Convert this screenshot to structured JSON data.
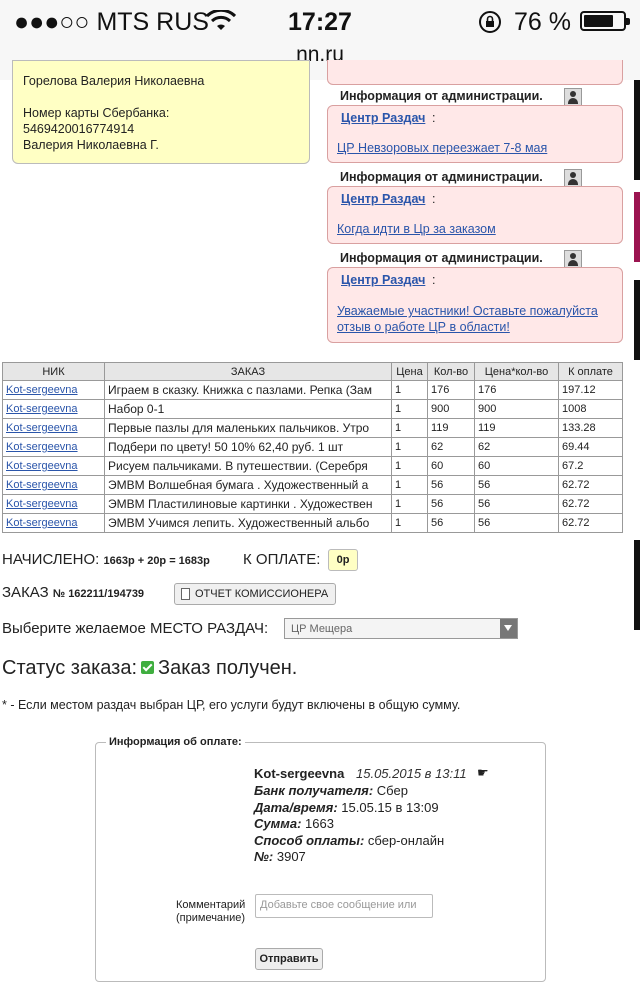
{
  "status_bar": {
    "carrier": "●●●○○ MTS RUS",
    "time": "17:27",
    "battery_percent": "76 %",
    "battery_level": 0.76,
    "url": "nn.ru"
  },
  "info_box": {
    "name": "Горелова Валерия Николаевна",
    "card_label": "Номер карты Сбербанка:",
    "card_number": "5469420016774914",
    "owner": "Валерия Николаевна Г."
  },
  "admin_messages": [
    {
      "title": "Информация от администрации.",
      "source": "Центр Раздач",
      "text": "ЦР Невзоровых переезжает 7-8 мая"
    },
    {
      "title": "Информация от администрации.",
      "source": "Центр Раздач",
      "text": "Когда идти в Цр за заказом"
    },
    {
      "title": "Информация от администрации.",
      "source": "Центр Раздач",
      "text": "Уважаемые участники! Оставьте пожалуйста отзыв о работе ЦР в области!"
    }
  ],
  "table": {
    "headers": [
      "НИК",
      "ЗАКАЗ",
      "Цена",
      "Кол-во",
      "Цена*кол-во",
      "К оплате"
    ],
    "rows": [
      [
        "Kot-sergeevna",
        "Играем в сказку. Книжка с пазлами. Репка (Зам",
        "1",
        "176",
        "176",
        "197.12"
      ],
      [
        "Kot-sergeevna",
        "Набор 0-1",
        "1",
        "900",
        "900",
        "1008"
      ],
      [
        "Kot-sergeevna",
        "Первые пазлы для маленьких пальчиков. Утро",
        "1",
        "119",
        "119",
        "133.28"
      ],
      [
        "Kot-sergeevna",
        "Подбери по цвету! 50 10% 62,40 руб. 1 шт",
        "1",
        "62",
        "62",
        "69.44"
      ],
      [
        "Kot-sergeevna",
        "Рисуем пальчиками. В путешествии. (Серебря",
        "1",
        "60",
        "60",
        "67.2"
      ],
      [
        "Kot-sergeevna",
        "ЭМВМ Волшебная бумага . Художественный а",
        "1",
        "56",
        "56",
        "62.72"
      ],
      [
        "Kot-sergeevna",
        "ЭМВМ Пластилиновые картинки . Художествен",
        "1",
        "56",
        "56",
        "62.72"
      ],
      [
        "Kot-sergeevna",
        "ЭМВМ Учимся лепить. Художественный альбо",
        "1",
        "56",
        "56",
        "62.72"
      ]
    ]
  },
  "summary": {
    "accrued_label": "НАЧИСЛЕНО:",
    "accrued_value": "1663р + 20р = 1683р",
    "to_pay_label": "К ОПЛАТЕ:",
    "to_pay_value": "0р",
    "order_label": "ЗАКАЗ",
    "order_number": "№ 162211/194739",
    "report_button": "ОТЧЕТ КОМИССИОНЕРА",
    "place_label": "Выберите желаемое МЕСТО РАЗДАЧ:",
    "place_value": "ЦР Мещера",
    "status_label": "Статус заказа:",
    "status_value": "Заказ получен.",
    "note": "* - Если местом раздач выбран ЦР, его услуги будут включены в общую сумму."
  },
  "payment_info": {
    "legend": "Информация об оплате:",
    "user": "Kot-sergeevna",
    "date": "15.05.2015 в 13:11",
    "hand_icon": "☛",
    "bank_label": "Банк получателя:",
    "bank_value": "Сбер",
    "datetime_label": "Дата/время:",
    "datetime_value": "15.05.15 в 13:09",
    "sum_label": "Сумма:",
    "sum_value": "1663",
    "method_label": "Способ оплаты:",
    "method_value": "сбер-онлайн",
    "number_label": "№:",
    "number_value": "3907",
    "comment_label_1": "Комментарий",
    "comment_label_2": "(примечание)",
    "comment_placeholder": "Добавьте свое сообщение или",
    "send_button": "Отправить"
  },
  "colors": {
    "link": "#2a55aa",
    "yellow_box": "#ffffc4",
    "pink_box": "#ffe8e8",
    "status_check": "#3fae3f"
  }
}
